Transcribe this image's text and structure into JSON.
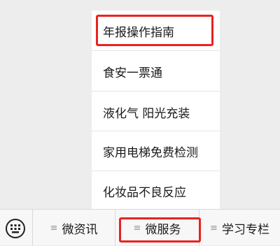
{
  "menu": {
    "items": [
      {
        "label": "年报操作指南"
      },
      {
        "label": "食安一票通"
      },
      {
        "label": "液化气 阳光充装"
      },
      {
        "label": "家用电梯免费检测"
      },
      {
        "label": "化妆品不良反应"
      }
    ]
  },
  "bottom_bar": {
    "keyboard_icon": "keyboard-icon",
    "tabs": [
      {
        "label": "微资讯",
        "icon": "menu-lines-icon"
      },
      {
        "label": "微服务",
        "icon": "menu-lines-icon"
      },
      {
        "label": "学习专栏",
        "icon": "menu-lines-icon"
      }
    ]
  },
  "colors": {
    "highlight": "#e8231f",
    "background": "#ededed",
    "menu_background": "#ffffff"
  }
}
